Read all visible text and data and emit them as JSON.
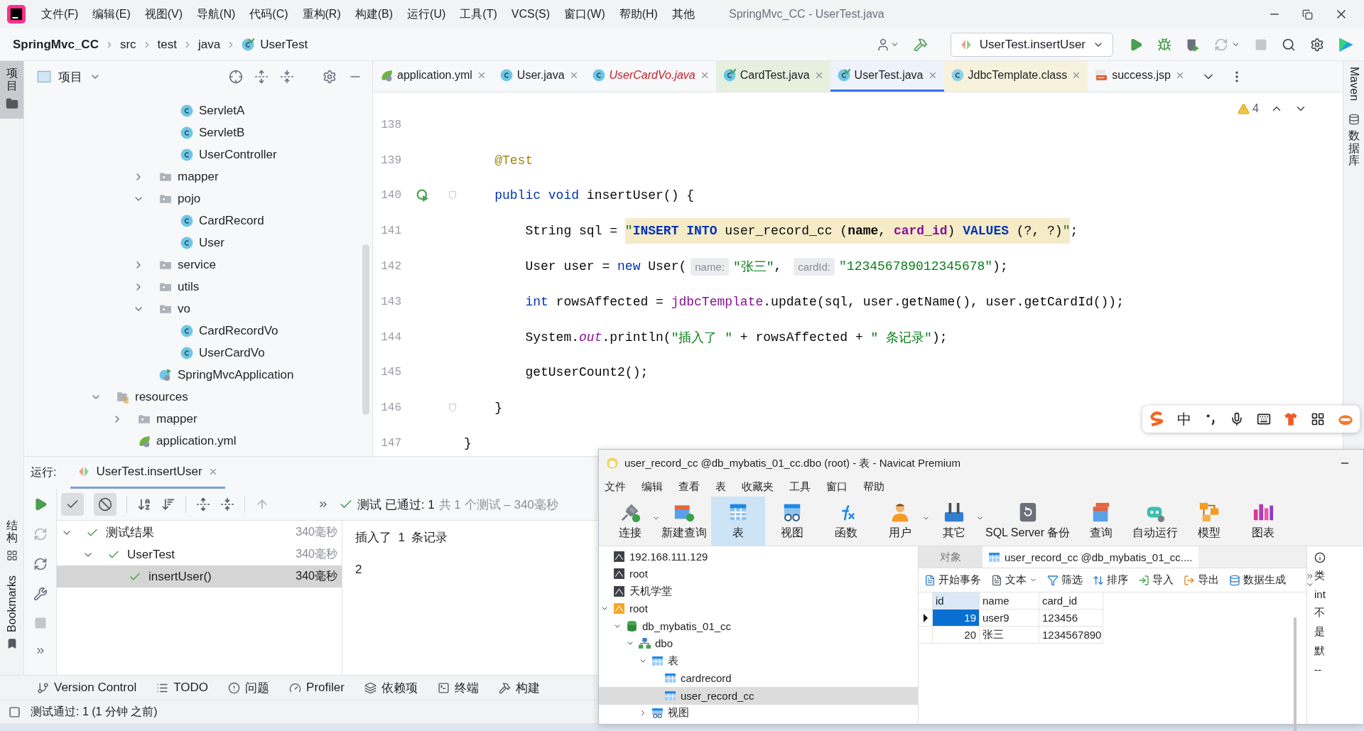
{
  "menu_bar": {
    "items": [
      "文件(F)",
      "编辑(E)",
      "视图(V)",
      "导航(N)",
      "代码(C)",
      "重构(R)",
      "构建(B)",
      "运行(U)",
      "工具(T)",
      "VCS(S)",
      "窗口(W)",
      "帮助(H)",
      "其他"
    ],
    "title": "SpringMvc_CC - UserTest.java"
  },
  "nav_bar": {
    "breadcrumb": [
      "SpringMvc_CC",
      "src",
      "test",
      "java",
      "UserTest"
    ],
    "run_config": "UserTest.insertUser"
  },
  "left_strip": {
    "top": [
      {
        "label": "项目",
        "kind": "cjk",
        "selected": true
      }
    ],
    "bottom": [
      {
        "label": "结构",
        "kind": "cjk",
        "selected": false
      },
      {
        "label": "Bookmarks",
        "kind": "latin",
        "selected": false
      }
    ]
  },
  "right_strip": [
    {
      "label": "Maven",
      "kind": "latin"
    },
    {
      "label": "数据库",
      "kind": "cjk"
    }
  ],
  "project_panel": {
    "title": "项目",
    "tree": [
      {
        "children": [
          {
            "children": [
              {
                "children": [
                  {
                    "label": "ServletA",
                    "kind": "class"
                  },
                  {
                    "label": "ServletB",
                    "kind": "class"
                  },
                  {
                    "label": "UserController",
                    "kind": "class"
                  }
                ]
              },
              {
                "label": "mapper",
                "kind": "folder",
                "expanded": false
              },
              {
                "label": "pojo",
                "kind": "folder",
                "expanded": true,
                "children": [
                  {
                    "label": "CardRecord",
                    "kind": "class"
                  },
                  {
                    "label": "User",
                    "kind": "class"
                  }
                ]
              },
              {
                "label": "service",
                "kind": "folder",
                "expanded": false
              },
              {
                "label": "utils",
                "kind": "folder",
                "expanded": false
              },
              {
                "label": "vo",
                "kind": "folder",
                "expanded": true,
                "children": [
                  {
                    "label": "CardRecordVo",
                    "kind": "class"
                  },
                  {
                    "label": "UserCardVo",
                    "kind": "class"
                  }
                ]
              },
              {
                "label": "SpringMvcApplication",
                "kind": "spring_app"
              }
            ]
          }
        ]
      },
      {
        "label": "resources",
        "kind": "resources",
        "expanded": true,
        "children": [
          {
            "label": "mapper",
            "kind": "folder",
            "expanded": false
          },
          {
            "label": "application.yml",
            "kind": "yml"
          }
        ]
      }
    ]
  },
  "editor": {
    "tabs": [
      {
        "label": "application.yml",
        "kind": "yml",
        "selected": false,
        "error": false
      },
      {
        "label": "User.java",
        "kind": "class",
        "selected": false,
        "error": false
      },
      {
        "label": "UserCardVo.java",
        "kind": "class",
        "selected": false,
        "error": true
      },
      {
        "label": "CardTest.java",
        "kind": "test_class",
        "selected": false,
        "error": false,
        "color": "#e7f0df"
      },
      {
        "label": "UserTest.java",
        "kind": "test_class",
        "selected": true,
        "error": false
      },
      {
        "label": "JdbcTemplate.class",
        "kind": "compiled",
        "selected": false,
        "error": false,
        "color": "#f6f2dc"
      },
      {
        "label": "success.jsp",
        "kind": "jsp",
        "selected": false,
        "error": false
      }
    ],
    "warnings": "4",
    "lines": [
      {
        "number": "138",
        "run_marker": false,
        "fold": false
      },
      {
        "number": "139",
        "run_marker": false,
        "fold": false,
        "tokens": [
          {
            "kind": "annotation",
            "text": "    @Test"
          }
        ]
      },
      {
        "number": "140",
        "run_marker": true,
        "fold": true,
        "tokens": [
          {
            "kind": "keyword",
            "text": "    public void"
          },
          {
            "kind": "plain",
            "text": " insertUser() {"
          }
        ]
      },
      {
        "number": "141",
        "run_marker": false,
        "fold": false,
        "tokens": [
          {
            "kind": "plain",
            "text": "        String sql = "
          },
          {
            "kind": "sql_quote",
            "text": "\""
          },
          {
            "kind": "sql_kw",
            "text": "INSERT INTO"
          },
          {
            "kind": "sql_text",
            "text": " user_record_cc ("
          },
          {
            "kind": "sql_name",
            "text": "name"
          },
          {
            "kind": "sql_text",
            "text": ", "
          },
          {
            "kind": "sql_col",
            "text": "card_id"
          },
          {
            "kind": "sql_text",
            "text": ") "
          },
          {
            "kind": "sql_kw",
            "text": "VALUES"
          },
          {
            "kind": "sql_text",
            "text": " (?, ?)"
          },
          {
            "kind": "sql_quote",
            "text": "\""
          },
          {
            "kind": "plain",
            "text": ";"
          }
        ]
      },
      {
        "number": "142",
        "run_marker": false,
        "fold": false,
        "tokens": [
          {
            "kind": "plain",
            "text": "        User user = "
          },
          {
            "kind": "keyword",
            "text": "new"
          },
          {
            "kind": "plain",
            "text": " User("
          },
          {
            "kind": "hint",
            "text": "name:"
          },
          {
            "kind": "string",
            "text": "\"张三\""
          },
          {
            "kind": "plain",
            "text": ", "
          },
          {
            "kind": "hint",
            "text": "cardId:"
          },
          {
            "kind": "string",
            "text": "\"123456789012345678\""
          },
          {
            "kind": "plain",
            "text": ");"
          }
        ]
      },
      {
        "number": "143",
        "run_marker": false,
        "fold": false,
        "tokens": [
          {
            "kind": "keyword",
            "text": "        int"
          },
          {
            "kind": "plain",
            "text": " rowsAffected = "
          },
          {
            "kind": "member",
            "text": "jdbcTemplate"
          },
          {
            "kind": "plain",
            "text": ".update(sql, user.getName(), user.getCardId());"
          }
        ]
      },
      {
        "number": "144",
        "run_marker": false,
        "fold": false,
        "tokens": [
          {
            "kind": "plain",
            "text": "        System."
          },
          {
            "kind": "static",
            "text": "out"
          },
          {
            "kind": "plain",
            "text": ".println("
          },
          {
            "kind": "string",
            "text": "\"插入了 \""
          },
          {
            "kind": "plain",
            "text": " + rowsAffected + "
          },
          {
            "kind": "string",
            "text": "\" 条记录\""
          },
          {
            "kind": "plain",
            "text": ");"
          }
        ]
      },
      {
        "number": "145",
        "run_marker": false,
        "fold": false,
        "tokens": [
          {
            "kind": "plain",
            "text": "        getUserCount2();"
          }
        ]
      },
      {
        "number": "146",
        "run_marker": false,
        "fold": true,
        "tokens": [
          {
            "kind": "plain",
            "text": "    }"
          }
        ]
      },
      {
        "number": "147",
        "run_marker": false,
        "fold": false,
        "tokens": [
          {
            "kind": "plain",
            "text": "}"
          }
        ]
      }
    ]
  },
  "ime_bar": {
    "mode": "中"
  },
  "run_panel": {
    "label": "运行:",
    "tab": "UserTest.insertUser",
    "status": "测试 已通过: 1",
    "status_detail": "共 1 个测试 – 340毫秒",
    "tree": [
      {
        "label": "测试结果",
        "time": "340毫秒",
        "expanded": true,
        "selected": false,
        "children": [
          {
            "label": "UserTest",
            "time": "340毫秒",
            "expanded": true,
            "selected": false,
            "children": [
              {
                "label": "insertUser()",
                "time": "340毫秒",
                "selected": true
              }
            ]
          }
        ]
      }
    ],
    "console": [
      "插入了  1  条记录",
      "2"
    ]
  },
  "tool_tabs": [
    {
      "label": "Version Control",
      "kind": "vcs"
    },
    {
      "label": "TODO",
      "kind": "list"
    },
    {
      "label": "问题",
      "kind": "problems"
    },
    {
      "label": "Profiler",
      "kind": "profiler"
    },
    {
      "label": "依赖项",
      "kind": "layers"
    },
    {
      "label": "终端",
      "kind": "terminal"
    },
    {
      "label": "构建",
      "kind": "hammer"
    }
  ],
  "status_bar": "测试通过: 1 (1 分钟 之前)",
  "navicat": {
    "title": "user_record_cc @db_mybatis_01_cc.dbo (root) - 表 - Navicat Premium",
    "menu": [
      "文件",
      "编辑",
      "查看",
      "表",
      "收藏夹",
      "工具",
      "窗口",
      "帮助"
    ],
    "toolbar": [
      {
        "label": "连接",
        "kind": "connect",
        "dropdown": true,
        "selected": false
      },
      {
        "label": "新建查询",
        "kind": "new_query",
        "dropdown": false,
        "selected": false
      },
      {
        "label": "表",
        "kind": "table",
        "dropdown": false,
        "selected": true
      },
      {
        "label": "视图",
        "kind": "view",
        "dropdown": false,
        "selected": false
      },
      {
        "label": "函数",
        "kind": "function",
        "dropdown": false,
        "selected": false
      },
      {
        "label": "用户",
        "kind": "user",
        "dropdown": true,
        "selected": false
      },
      {
        "label": "其它",
        "kind": "tools",
        "dropdown": true,
        "selected": false
      },
      {
        "label": "SQL Server 备份",
        "kind": "backup",
        "dropdown": false,
        "selected": false
      },
      {
        "label": "查询",
        "kind": "query",
        "dropdown": false,
        "selected": false
      },
      {
        "label": "自动运行",
        "kind": "robot",
        "dropdown": false,
        "selected": false
      },
      {
        "label": "模型",
        "kind": "model",
        "dropdown": false,
        "selected": false
      },
      {
        "label": "图表",
        "kind": "chart",
        "dropdown": false,
        "selected": false
      }
    ],
    "tree": [
      {
        "label": "192.168.111.129",
        "kind": "server",
        "selected": false
      },
      {
        "label": "root",
        "kind": "server",
        "selected": false
      },
      {
        "label": "天机学堂",
        "kind": "server",
        "selected": false
      },
      {
        "label": "root",
        "kind": "server_on",
        "expanded": true,
        "selected": false,
        "children": [
          {
            "label": "db_mybatis_01_cc",
            "kind": "database",
            "expanded": true,
            "selected": false,
            "children": [
              {
                "label": "dbo",
                "kind": "schema",
                "expanded": true,
                "selected": false,
                "children": [
                  {
                    "label": "表",
                    "kind": "tables",
                    "expanded": true,
                    "selected": false,
                    "children": [
                      {
                        "label": "cardrecord",
                        "kind": "table",
                        "selected": false
                      },
                      {
                        "label": "user_record_cc",
                        "kind": "table",
                        "selected": true
                      }
                    ]
                  },
                  {
                    "label": "视图",
                    "kind": "views",
                    "expanded": false,
                    "selected": false
                  }
                ]
              }
            ]
          }
        ]
      }
    ],
    "tabs": [
      {
        "label": "对象",
        "selected": false
      },
      {
        "label": "user_record_cc @db_mybatis_01_cc....",
        "selected": true
      }
    ],
    "table_toolbar": [
      {
        "label": "开始事务",
        "kind": "transaction",
        "dropdown": false
      },
      {
        "label": "文本",
        "kind": "text",
        "dropdown": true
      },
      {
        "label": "筛选",
        "kind": "filter",
        "dropdown": false
      },
      {
        "label": "排序",
        "kind": "sort",
        "dropdown": false
      },
      {
        "label": "导入",
        "kind": "import",
        "dropdown": false
      },
      {
        "label": "导出",
        "kind": "export",
        "dropdown": false
      },
      {
        "label": "数据生成",
        "kind": "generate",
        "dropdown": false
      }
    ],
    "table": {
      "columns": [
        "id",
        "name",
        "card_id"
      ],
      "rows": [
        {
          "cells": [
            "19",
            "user9",
            "123456"
          ],
          "selected": true
        },
        {
          "cells": [
            "20",
            "张三",
            "1234567890"
          ],
          "selected": false
        }
      ]
    },
    "info_panel": [
      "类",
      "int",
      "不",
      "是",
      "默",
      "--"
    ]
  }
}
